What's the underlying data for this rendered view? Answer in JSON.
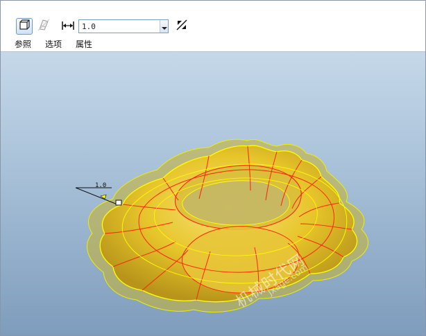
{
  "toolbar": {
    "surface_button_icon": "solid-surface-icon",
    "quilt_button_icon": "quilt-surface-icon",
    "thickness_icon": "dimension-arrows-icon",
    "thickness_value": "1.0",
    "flip_icon": "flip-direction-icon"
  },
  "tabs": [
    {
      "label": "参照"
    },
    {
      "label": "选项"
    },
    {
      "label": "属性"
    }
  ],
  "viewport": {
    "dimension_value": "1.0",
    "watermark_cn": "机械时代网",
    "watermark_en": "jxage.com"
  },
  "colors": {
    "model_fill": "#e9c624",
    "edge_yellow": "#ffff00",
    "edge_red": "#ff2200",
    "background_top": "#c5d8e9",
    "background_bottom": "#7e9cbc"
  }
}
